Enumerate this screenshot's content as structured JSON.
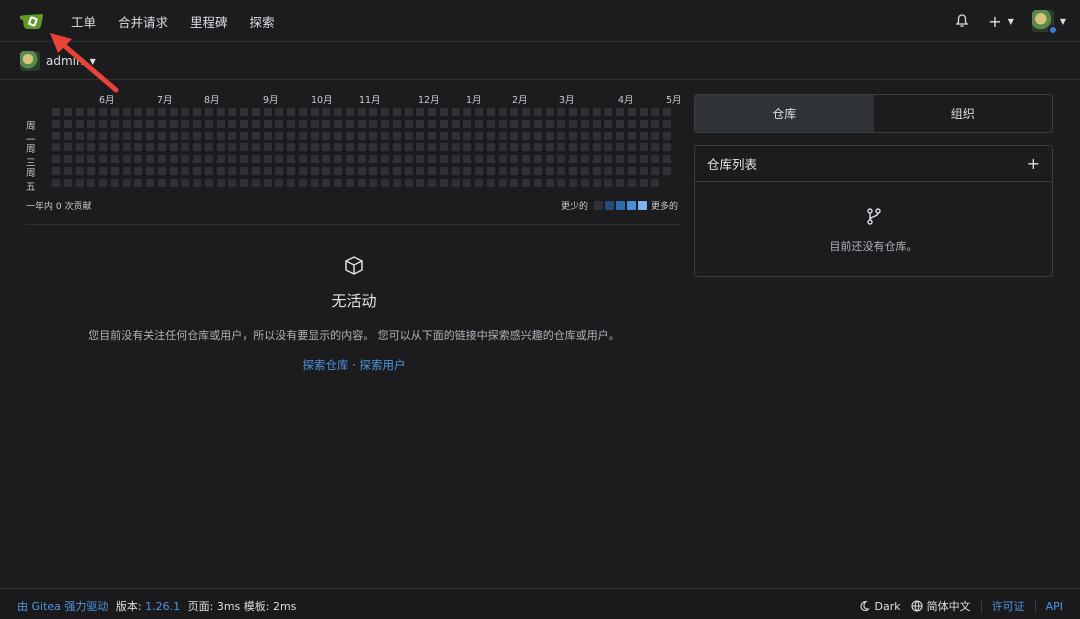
{
  "nav": {
    "items": [
      {
        "label": "工单",
        "name": "nav-issues"
      },
      {
        "label": "合并请求",
        "name": "nav-pull-requests"
      },
      {
        "label": "里程碑",
        "name": "nav-milestones"
      },
      {
        "label": "探索",
        "name": "nav-explore"
      }
    ],
    "plus": "+"
  },
  "context": {
    "username": "admin"
  },
  "heatmap": {
    "months": [
      "6月",
      "7月",
      "8月",
      "9月",
      "10月",
      "11月",
      "12月",
      "1月",
      "2月",
      "3月",
      "4月",
      "5月"
    ],
    "days": [
      "周一",
      "周三",
      "周五"
    ],
    "summary": "一年内 0 次贡献",
    "less": "更少的",
    "more": "更多的",
    "scale_colors": [
      "#2f3136",
      "#214d7a",
      "#2f6cab",
      "#4a8fd6",
      "#7bb4ee"
    ],
    "contributions": 0
  },
  "empty": {
    "title": "无活动",
    "description": "您目前没有关注任何仓库或用户，所以没有要显示的内容。 您可以从下面的链接中探索感兴趣的仓库或用户。",
    "link_repos": "探索仓库",
    "dot": " · ",
    "link_users": "探索用户"
  },
  "tabs": [
    {
      "label": "仓库",
      "active": true
    },
    {
      "label": "组织",
      "active": false
    }
  ],
  "repo_panel": {
    "title": "仓库列表",
    "add": "+",
    "empty_text": "目前还没有仓库。"
  },
  "footer": {
    "powered": "由 Gitea 强力驱动",
    "version_label": "版本:",
    "version": "1.26.1",
    "page_time": "页面: 3ms 模板: 2ms",
    "theme": "Dark",
    "language": "简体中文",
    "license": "许可证",
    "api": "API"
  },
  "colors": {
    "accent": "#4f96e0",
    "annotation_arrow": "#e8433a",
    "logo": "#609926"
  }
}
